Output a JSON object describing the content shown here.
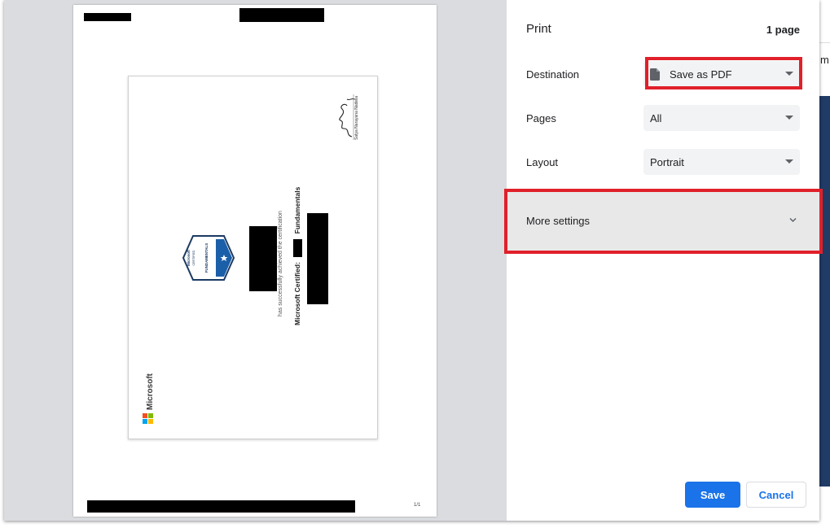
{
  "background": {
    "fragment_text": "m"
  },
  "preview": {
    "page_label": "1/1",
    "certificate": {
      "brand": "Microsoft",
      "badge_top": "Microsoft",
      "badge_mid": "CERTIFIED",
      "badge_bottom": "FUNDAMENTALS",
      "achievement_text": "has successfully achieved the certification",
      "cert_prefix": "Microsoft Certified:",
      "cert_suffix": "Fundamentals",
      "signer_name": "Satya Narayana Nadella"
    }
  },
  "panel": {
    "title": "Print",
    "page_count": "1 page",
    "destination": {
      "label": "Destination",
      "value": "Save as PDF"
    },
    "pages": {
      "label": "Pages",
      "value": "All"
    },
    "layout": {
      "label": "Layout",
      "value": "Portrait"
    },
    "more_settings": "More settings",
    "save_label": "Save",
    "cancel_label": "Cancel"
  },
  "colors": {
    "accent": "#1a73e8",
    "highlight": "#e0202a",
    "badge_blue": "#1b5fa8"
  }
}
